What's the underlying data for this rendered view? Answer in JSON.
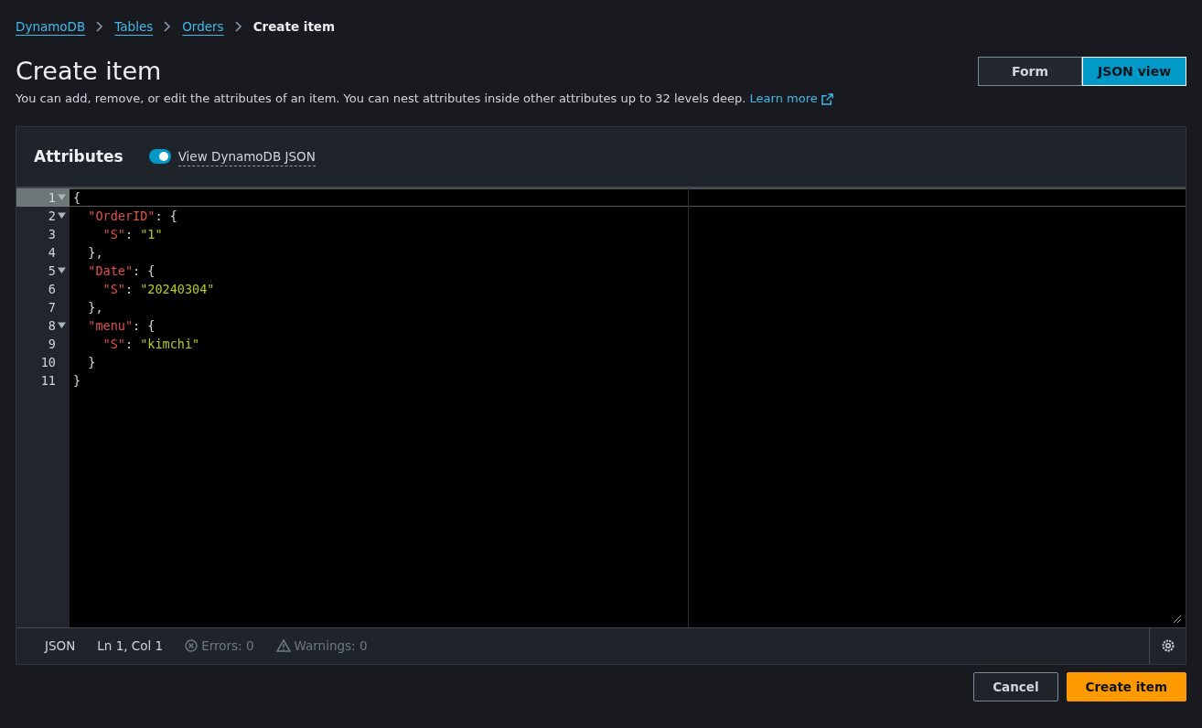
{
  "breadcrumbs": [
    {
      "label": "DynamoDB",
      "kind": "link"
    },
    {
      "label": "Tables",
      "kind": "link"
    },
    {
      "label": "Orders",
      "kind": "link"
    },
    {
      "label": "Create item",
      "kind": "current"
    }
  ],
  "title": "Create item",
  "description": "You can add, remove, or edit the attributes of an item. You can nest attributes inside other attributes up to 32 levels deep.",
  "learn_more": "Learn more",
  "view_toggle": [
    {
      "label": "Form",
      "selected": false
    },
    {
      "label": "JSON view",
      "selected": true
    }
  ],
  "attributes_panel": {
    "heading": "Attributes",
    "dynamodb_json_switch": {
      "label": "View DynamoDB JSON",
      "on": true
    }
  },
  "editor": {
    "lines": [
      {
        "number": "1",
        "foldable": true,
        "active": true,
        "tokens": [
          {
            "kind": "punct",
            "text": "{"
          }
        ]
      },
      {
        "number": "2",
        "foldable": true,
        "active": false,
        "tokens": [
          {
            "kind": "key",
            "text": "  \"OrderID\""
          },
          {
            "kind": "punct",
            "text": ": {"
          }
        ]
      },
      {
        "number": "3",
        "foldable": false,
        "active": false,
        "tokens": [
          {
            "kind": "key",
            "text": "    \"S\""
          },
          {
            "kind": "punct",
            "text": ": "
          },
          {
            "kind": "string",
            "text": "\"1\""
          }
        ]
      },
      {
        "number": "4",
        "foldable": false,
        "active": false,
        "tokens": [
          {
            "kind": "punct",
            "text": "  },"
          }
        ]
      },
      {
        "number": "5",
        "foldable": true,
        "active": false,
        "tokens": [
          {
            "kind": "key",
            "text": "  \"Date\""
          },
          {
            "kind": "punct",
            "text": ": {"
          }
        ]
      },
      {
        "number": "6",
        "foldable": false,
        "active": false,
        "tokens": [
          {
            "kind": "key",
            "text": "    \"S\""
          },
          {
            "kind": "punct",
            "text": ": "
          },
          {
            "kind": "string",
            "text": "\"20240304\""
          }
        ]
      },
      {
        "number": "7",
        "foldable": false,
        "active": false,
        "tokens": [
          {
            "kind": "punct",
            "text": "  },"
          }
        ]
      },
      {
        "number": "8",
        "foldable": true,
        "active": false,
        "tokens": [
          {
            "kind": "key",
            "text": "  \"menu\""
          },
          {
            "kind": "punct",
            "text": ": {"
          }
        ]
      },
      {
        "number": "9",
        "foldable": false,
        "active": false,
        "tokens": [
          {
            "kind": "key",
            "text": "    \"S\""
          },
          {
            "kind": "punct",
            "text": ": "
          },
          {
            "kind": "string",
            "text": "\"kimchi\""
          }
        ]
      },
      {
        "number": "10",
        "foldable": false,
        "active": false,
        "tokens": [
          {
            "kind": "punct",
            "text": "  }"
          }
        ]
      },
      {
        "number": "11",
        "foldable": false,
        "active": false,
        "tokens": [
          {
            "kind": "punct",
            "text": "}"
          }
        ]
      }
    ],
    "status_bar": {
      "language": "JSON",
      "position": "Ln 1, Col 1",
      "errors": "Errors: 0",
      "warnings": "Warnings: 0"
    }
  },
  "buttons": [
    {
      "label": "Cancel",
      "kind": "secondary"
    },
    {
      "label": "Create item",
      "kind": "primary"
    }
  ]
}
